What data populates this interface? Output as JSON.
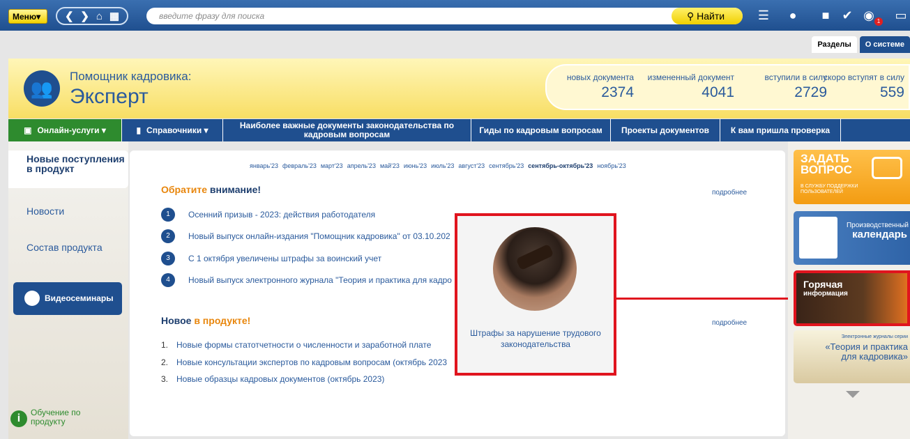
{
  "toolbar": {
    "menu_label": "Меню",
    "menu_caret": "▾",
    "back_glyph": "❮",
    "forward_glyph": "❯",
    "home_glyph": "⌂",
    "grid_glyph": "▦",
    "search_placeholder": "введите фразу для поиска",
    "find_label": "Найти",
    "list_glyph": "☰",
    "notification_count": "1"
  },
  "section_tabs": {
    "sections": "Разделы",
    "about": "О системе"
  },
  "header": {
    "subtitle": "Помощник кадровика:",
    "title": "Эксперт",
    "stats": [
      {
        "label": "новых документа",
        "value": "2374"
      },
      {
        "label": "измененный документ",
        "value": "4041"
      },
      {
        "label": "вступили в силу",
        "value": "2729"
      },
      {
        "label": "скоро вступят в силу",
        "value": "559"
      }
    ]
  },
  "navbar": {
    "online": "Онлайн-услуги ▾",
    "refs": "Справочники ▾",
    "important": "Наиболее важные документы законодательства по кадровым вопросам",
    "guides": "Гиды по кадровым вопросам",
    "projects": "Проекты документов",
    "inspection": "К вам пришла проверка"
  },
  "sidebar": {
    "active": "Новые поступления в продукт",
    "news": "Новости",
    "composition": "Состав продукта",
    "webinars": "Видеосеминары",
    "learning": "Обучение по продукту"
  },
  "main": {
    "months": [
      "январь'23",
      "февраль'23",
      "март'23",
      "апрель'23",
      "май'23",
      "июнь'23",
      "июль'23",
      "август'23",
      "сентябрь'23"
    ],
    "current_month": "сентябрь-октябрь'23",
    "next_month": "ноябрь'23",
    "attention_title_a": "Обратите",
    "attention_title_b": "внимание!",
    "more": "подробнее",
    "attention_items": [
      {
        "num": "1",
        "text": "Осенний призыв - 2023: действия работодателя"
      },
      {
        "num": "2",
        "text": "Новый выпуск онлайн-издания \"Помощник кадровика\" от 03.10.202"
      },
      {
        "num": "3",
        "text": "С 1 октября увеличены штрафы за воинский учет"
      },
      {
        "num": "4",
        "text": "Новый выпуск электронного журнала \"Теория и практика для кадро"
      }
    ],
    "new_title_a": "Новое",
    "new_title_b": "в продукте!",
    "new_items": [
      {
        "num": "1.",
        "text": "Новые формы статотчетности о численности и заработной плате"
      },
      {
        "num": "2.",
        "text": "Новые консультации экспертов по кадровым вопросам (октябрь 2023"
      },
      {
        "num": "3.",
        "text": "Новые образцы кадровых документов (октябрь 2023)"
      }
    ]
  },
  "popup": {
    "caption": "Штрафы за нарушение трудового законодательства"
  },
  "right": {
    "ask_title": "ЗАДАТЬ ВОПРОС",
    "ask_sub": "В СЛУЖБУ ПОДДЕРЖКИ ПОЛЬЗОВАТЕЛЕЙ",
    "cal_t1": "Производственный",
    "cal_t2": "календарь",
    "hot_t1": "Горячая",
    "hot_t2": "информация",
    "jour_t1": "Электронные журналы серии",
    "jour_t2": "«Теория и практика для кадровика»"
  },
  "colors": {
    "brand_blue": "#1f4f8f",
    "accent_yellow": "#f2d200",
    "highlight_red": "#e0141e",
    "online_green": "#2e8b2e"
  }
}
